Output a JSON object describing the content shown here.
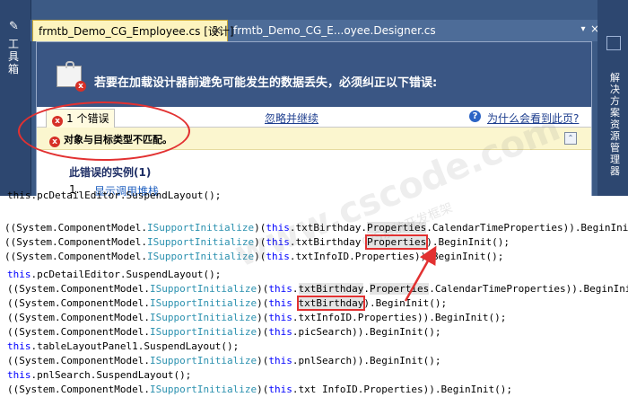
{
  "toolbox": {
    "label": "工具箱"
  },
  "right_panel": {
    "label": "解决方案资源管理器"
  },
  "tabs": [
    {
      "label": "frmtb_Demo_CG_Employee.cs [设计]",
      "close": "×"
    },
    {
      "label": "frmtb_Demo_CG_E...oyee.Designer.cs"
    }
  ],
  "tab_controls": {
    "dropdown": "▾",
    "close": "×"
  },
  "error_panel": {
    "header_message": "若要在加载设计器前避免可能发生的数据丢失，必须纠正以下错误:",
    "error_count_label": "1 个错误",
    "ignore_link": "忽略并继续",
    "why_link": "为什么会看到此页?",
    "help_glyph": "?",
    "error_glyph": "x",
    "error_message": "对象与目标类型不匹配。",
    "collapse_glyph": "⌃",
    "instances_title": "此错误的实例(1)",
    "instance_number": "1.",
    "instance_link": "显示调用堆栈"
  },
  "watermark": {
    "main": "www.cscode.com",
    "sub": "C/S系统开发框架"
  },
  "code": {
    "line0": "this.pcDetailEditor.SuspendLayout();",
    "kw_this": "this",
    "cast_open": "((",
    "ns_prefix": "System.ComponentModel.",
    "iface": "ISupportInitialize",
    "close_paren": ")",
    "dot_txtBirthday_dot": ".txtBirthday.",
    "dot_txtBirthday_space": ".txtBirthday ",
    "txtBirthday": "txtBirthday",
    "properties": "Properties",
    "calendar_tail": ".CalendarTimeProperties)).BeginInit();",
    "begininit_close_paren": ").BeginInit();",
    "begininit_dbl": ")).BeginInit();",
    "txtInfoID_props": ".txtInfoID.Properties)).BeginInit();",
    "txtInfoID_props2": ".txtInfoID.Properties)).BeginInit();",
    "picSearch": ".picSearch)).BeginInit();",
    "pnlSearch": ".pnlSearch)).BeginInit();",
    "pcDetail_suspend": ".pcDetailEditor.SuspendLayout();",
    "tlp_suspend": ".tableLayoutPanel1.SuspendLayout();",
    "pnl_suspend": ".pnlSearch.SuspendLayout();",
    "txt_infoid_last": ".txt InfoID.Properties)).BeginInit();",
    "space": " "
  }
}
